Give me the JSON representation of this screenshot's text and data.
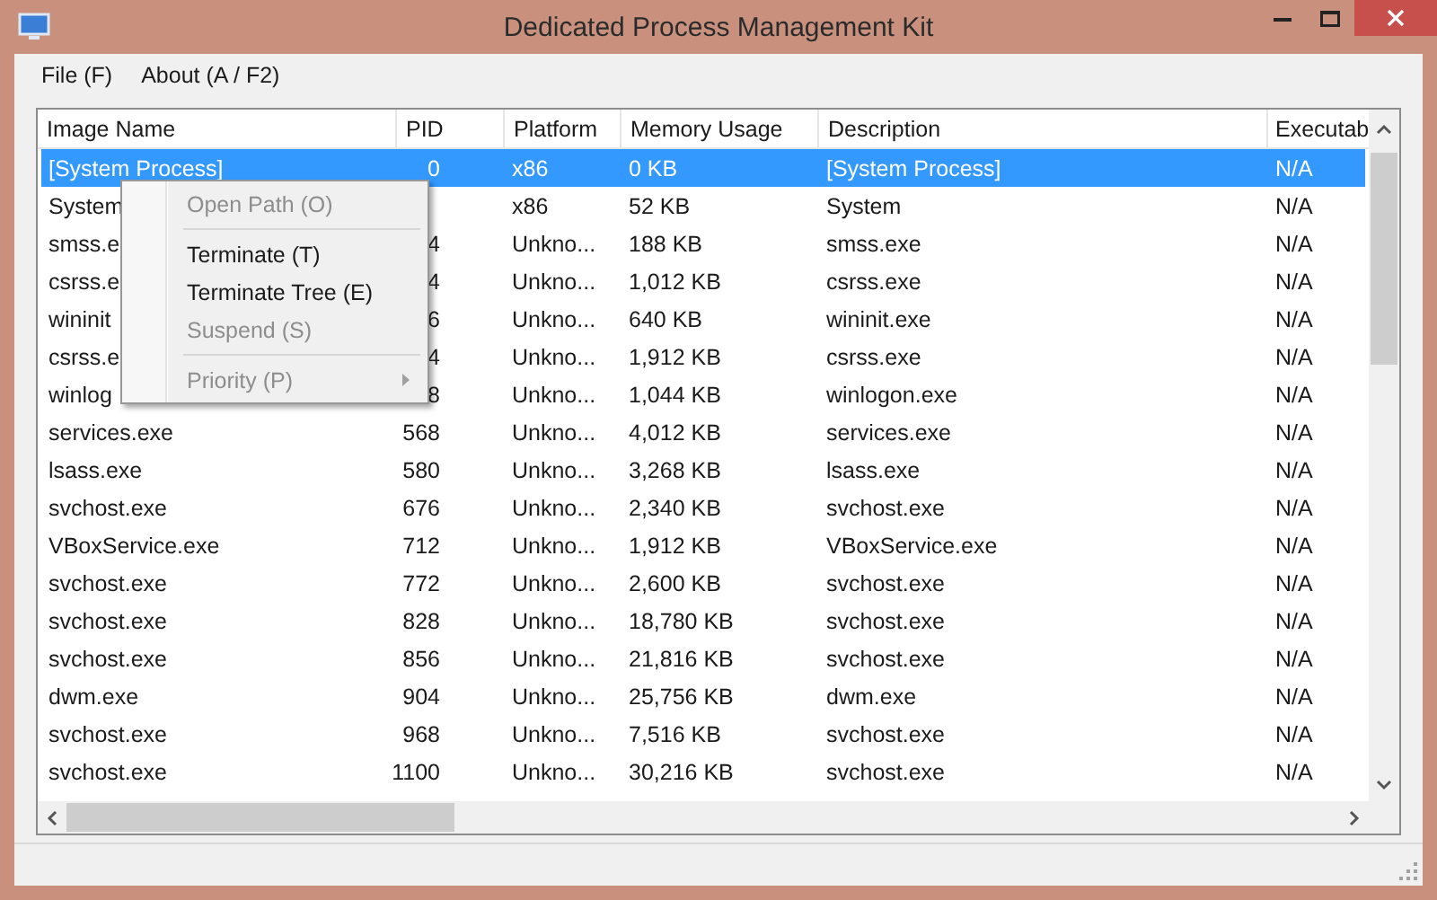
{
  "window": {
    "title": "Dedicated Process Management Kit"
  },
  "menu_bar": [
    "File (F)",
    "About (A / F2)"
  ],
  "table": {
    "columns": [
      "Image Name",
      "PID",
      "Platform",
      "Memory Usage",
      "Description",
      "Executab"
    ],
    "rows": [
      {
        "selected": true,
        "cells": [
          "[System Process]",
          "0",
          "x86",
          "0 KB",
          "[System Process]",
          "N/A"
        ]
      },
      {
        "selected": false,
        "cells": [
          "System",
          "",
          "x86",
          "52 KB",
          "System",
          "N/A"
        ]
      },
      {
        "selected": false,
        "cells": [
          "smss.e",
          "4",
          "Unkno...",
          "188 KB",
          "smss.exe",
          "N/A"
        ]
      },
      {
        "selected": false,
        "cells": [
          "csrss.e",
          "4",
          "Unkno...",
          "1,012 KB",
          "csrss.exe",
          "N/A"
        ]
      },
      {
        "selected": false,
        "cells": [
          "wininit",
          "6",
          "Unkno...",
          "640 KB",
          "wininit.exe",
          "N/A"
        ]
      },
      {
        "selected": false,
        "cells": [
          "csrss.e",
          "4",
          "Unkno...",
          "1,912 KB",
          "csrss.exe",
          "N/A"
        ]
      },
      {
        "selected": false,
        "cells": [
          "winlog",
          "8",
          "Unkno...",
          "1,044 KB",
          "winlogon.exe",
          "N/A"
        ]
      },
      {
        "selected": false,
        "cells": [
          "services.exe",
          "568",
          "Unkno...",
          "4,012 KB",
          "services.exe",
          "N/A"
        ]
      },
      {
        "selected": false,
        "cells": [
          "lsass.exe",
          "580",
          "Unkno...",
          "3,268 KB",
          "lsass.exe",
          "N/A"
        ]
      },
      {
        "selected": false,
        "cells": [
          "svchost.exe",
          "676",
          "Unkno...",
          "2,340 KB",
          "svchost.exe",
          "N/A"
        ]
      },
      {
        "selected": false,
        "cells": [
          "VBoxService.exe",
          "712",
          "Unkno...",
          "1,912 KB",
          "VBoxService.exe",
          "N/A"
        ]
      },
      {
        "selected": false,
        "cells": [
          "svchost.exe",
          "772",
          "Unkno...",
          "2,600 KB",
          "svchost.exe",
          "N/A"
        ]
      },
      {
        "selected": false,
        "cells": [
          "svchost.exe",
          "828",
          "Unkno...",
          "18,780 KB",
          "svchost.exe",
          "N/A"
        ]
      },
      {
        "selected": false,
        "cells": [
          "svchost.exe",
          "856",
          "Unkno...",
          "21,816 KB",
          "svchost.exe",
          "N/A"
        ]
      },
      {
        "selected": false,
        "cells": [
          "dwm.exe",
          "904",
          "Unkno...",
          "25,756 KB",
          "dwm.exe",
          "N/A"
        ]
      },
      {
        "selected": false,
        "cells": [
          "svchost.exe",
          "968",
          "Unkno...",
          "7,516 KB",
          "svchost.exe",
          "N/A"
        ]
      },
      {
        "selected": false,
        "cells": [
          "svchost.exe",
          "1100",
          "Unkno...",
          "30,216 KB",
          "svchost.exe",
          "N/A"
        ]
      }
    ]
  },
  "context_menu": [
    {
      "kind": "item",
      "label": "Open Path (O)",
      "disabled": true
    },
    {
      "kind": "separator"
    },
    {
      "kind": "item",
      "label": "Terminate (T)",
      "disabled": false
    },
    {
      "kind": "item",
      "label": "Terminate Tree (E)",
      "disabled": false
    },
    {
      "kind": "item",
      "label": "Suspend (S)",
      "disabled": true
    },
    {
      "kind": "separator"
    },
    {
      "kind": "submenu",
      "label": "Priority (P)",
      "disabled": true
    }
  ]
}
